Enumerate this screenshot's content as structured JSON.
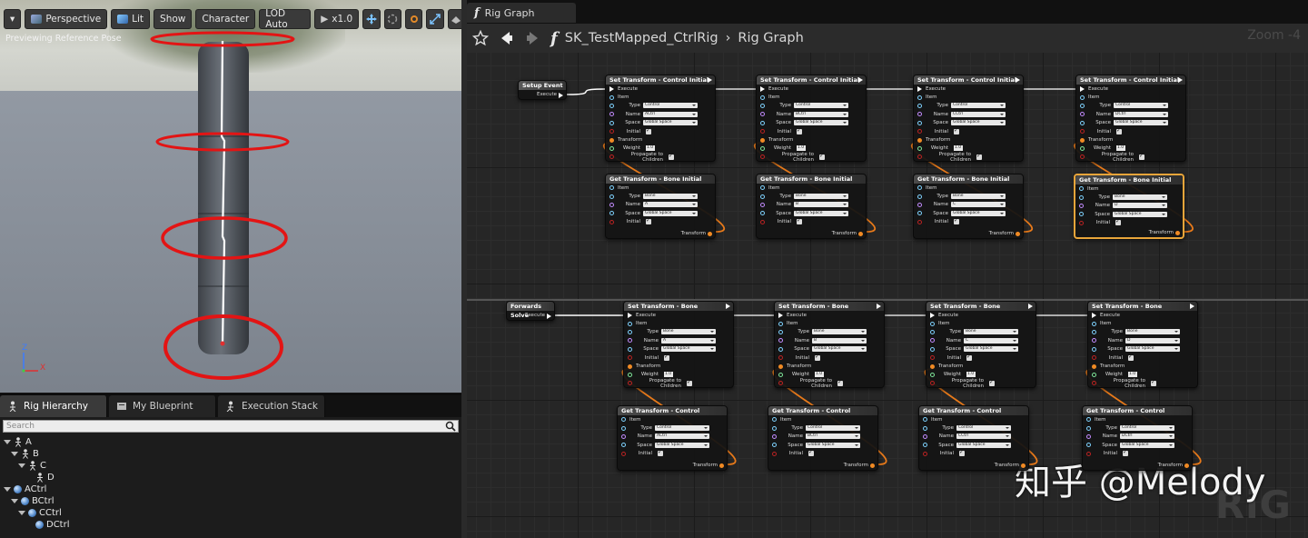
{
  "viewport": {
    "toolbar": {
      "menu": "▾",
      "perspective": "Perspective",
      "lit": "Lit",
      "show": "Show",
      "character": "Character",
      "lod": "LOD Auto",
      "speed": "x1.0"
    },
    "preview_label": "Previewing Reference Pose",
    "axis": {
      "z": "Z",
      "x": "X"
    }
  },
  "panel": {
    "tabs": [
      {
        "label": "Rig Hierarchy",
        "icon": "rig-hierarchy-icon"
      },
      {
        "label": "My Blueprint",
        "icon": "blueprint-icon"
      },
      {
        "label": "Execution Stack",
        "icon": "execution-stack-icon"
      }
    ],
    "search_placeholder": "Search",
    "tree": [
      {
        "label": "A",
        "kind": "bone",
        "depth": 0
      },
      {
        "label": "B",
        "kind": "bone",
        "depth": 1
      },
      {
        "label": "C",
        "kind": "bone",
        "depth": 2
      },
      {
        "label": "D",
        "kind": "bone",
        "depth": 3
      },
      {
        "label": "ACtrl",
        "kind": "control",
        "depth": 0
      },
      {
        "label": "BCtrl",
        "kind": "control",
        "depth": 1
      },
      {
        "label": "CCtrl",
        "kind": "control",
        "depth": 2
      },
      {
        "label": "DCtrl",
        "kind": "control",
        "depth": 3
      }
    ]
  },
  "graph": {
    "tab_label": "Rig Graph",
    "breadcrumb_root": "SK_TestMapped_CtrlRig",
    "breadcrumb_sep": "›",
    "breadcrumb_current": "Rig Graph",
    "zoom": "Zoom -4",
    "watermark": "知乎 @Melody",
    "rig_mark": "RiG",
    "setup_event": {
      "title": "Setup Event",
      "pin": "Execute"
    },
    "forwards_solve": {
      "title": "Forwards Solve",
      "pin": "Execute"
    },
    "labels": {
      "execute": "Execute",
      "item": "Item",
      "type": "Type",
      "name": "Name",
      "space": "Space",
      "initial": "Initial",
      "transform": "Transform",
      "weight": "Weight",
      "propagate": "Propagate to Children"
    },
    "set_control_initial": {
      "title": "Set Transform - Control Initial",
      "type": "Control",
      "space": "Global Space",
      "weight": "1.0",
      "names": [
        "ACtrl",
        "BCtrl",
        "CCtrl",
        "DCtrl"
      ]
    },
    "get_bone_initial": {
      "title": "Get Transform - Bone Initial",
      "type": "Bone",
      "space": "Global Space",
      "names": [
        "A",
        "B",
        "C",
        "D"
      ]
    },
    "set_bone": {
      "title": "Set Transform - Bone",
      "type": "Bone",
      "space": "Global Space",
      "weight": "1.0",
      "names": [
        "A",
        "B",
        "C",
        "D"
      ]
    },
    "get_control": {
      "title": "Get Transform - Control",
      "type": "Control",
      "space": "Global Space",
      "names": [
        "ACtrl",
        "BCtrl",
        "CCtrl",
        "DCtrl"
      ]
    }
  }
}
